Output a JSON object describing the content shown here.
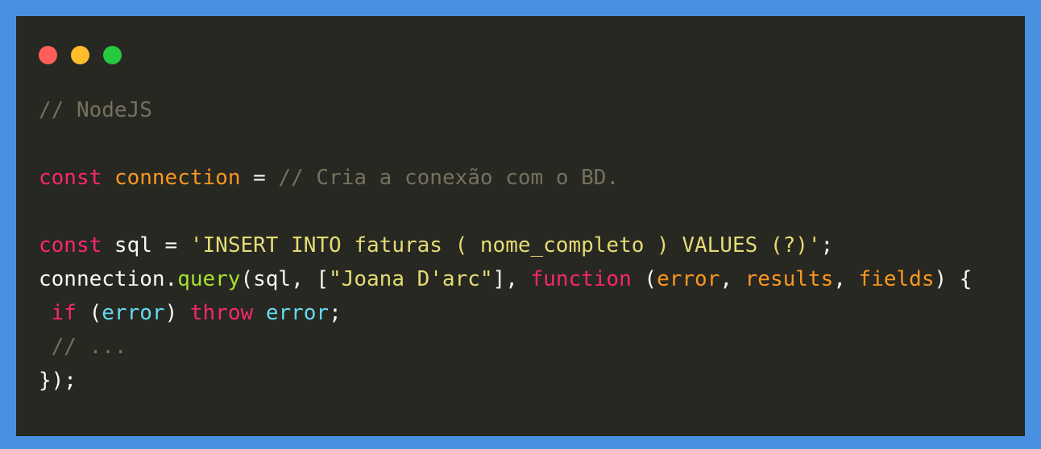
{
  "frame": {
    "border_color": "#4a90e2",
    "window_background": "#272822"
  },
  "titlebar": {
    "dots": [
      {
        "name": "close-dot",
        "color": "#ff5f56"
      },
      {
        "name": "minimize-dot",
        "color": "#ffbd2e"
      },
      {
        "name": "maximize-dot",
        "color": "#27c93f"
      }
    ]
  },
  "palette": {
    "plain": "#f8f8f2",
    "comment": "#75715e",
    "keyword": "#f92672",
    "variable": "#fd971f",
    "string": "#e6db74",
    "function": "#a6e22e",
    "identifier": "#66d9ef"
  },
  "code": {
    "language": "javascript",
    "plain_text": "// NodeJS\n\nconst connection = // Cria a conexão com o BD.\n\nconst sql = 'INSERT INTO faturas ( nome_completo ) VALUES (?)';\nconnection.query(sql, [\"Joana D'arc\"], function (error, results, fields) {\n if (error) throw error;\n // ...\n});",
    "lines": [
      {
        "id": "line-1",
        "tokens": [
          {
            "text": "// NodeJS",
            "type": "comment"
          }
        ]
      },
      {
        "id": "line-2",
        "tokens": []
      },
      {
        "id": "line-3",
        "tokens": [
          {
            "text": "const",
            "type": "keyword"
          },
          {
            "text": " ",
            "type": "plain"
          },
          {
            "text": "connection",
            "type": "var"
          },
          {
            "text": " = ",
            "type": "plain"
          },
          {
            "text": "// Cria a conexão com o BD.",
            "type": "comment"
          }
        ]
      },
      {
        "id": "line-4",
        "tokens": []
      },
      {
        "id": "line-5",
        "tokens": [
          {
            "text": "const",
            "type": "keyword"
          },
          {
            "text": " sql = ",
            "type": "plain"
          },
          {
            "text": "'INSERT INTO faturas ( nome_completo ) VALUES (?)'",
            "type": "string"
          },
          {
            "text": ";",
            "type": "plain"
          }
        ]
      },
      {
        "id": "line-6",
        "tokens": [
          {
            "text": "connection.",
            "type": "plain"
          },
          {
            "text": "query",
            "type": "func"
          },
          {
            "text": "(sql, [",
            "type": "plain"
          },
          {
            "text": "\"Joana D'arc\"",
            "type": "string"
          },
          {
            "text": "], ",
            "type": "plain"
          },
          {
            "text": "function",
            "type": "keyword"
          },
          {
            "text": " (",
            "type": "plain"
          },
          {
            "text": "error",
            "type": "param"
          },
          {
            "text": ", ",
            "type": "plain"
          },
          {
            "text": "results",
            "type": "param"
          },
          {
            "text": ", ",
            "type": "plain"
          },
          {
            "text": "fields",
            "type": "param"
          },
          {
            "text": ") {",
            "type": "plain"
          }
        ]
      },
      {
        "id": "line-7",
        "tokens": [
          {
            "text": " ",
            "type": "plain"
          },
          {
            "text": "if",
            "type": "keyword"
          },
          {
            "text": " (",
            "type": "plain"
          },
          {
            "text": "error",
            "type": "ident"
          },
          {
            "text": ") ",
            "type": "plain"
          },
          {
            "text": "throw",
            "type": "keyword"
          },
          {
            "text": " ",
            "type": "plain"
          },
          {
            "text": "error",
            "type": "ident"
          },
          {
            "text": ";",
            "type": "plain"
          }
        ]
      },
      {
        "id": "line-8",
        "tokens": [
          {
            "text": " ",
            "type": "plain"
          },
          {
            "text": "// ...",
            "type": "comment"
          }
        ]
      },
      {
        "id": "line-9",
        "tokens": [
          {
            "text": "});",
            "type": "plain"
          }
        ]
      }
    ]
  }
}
